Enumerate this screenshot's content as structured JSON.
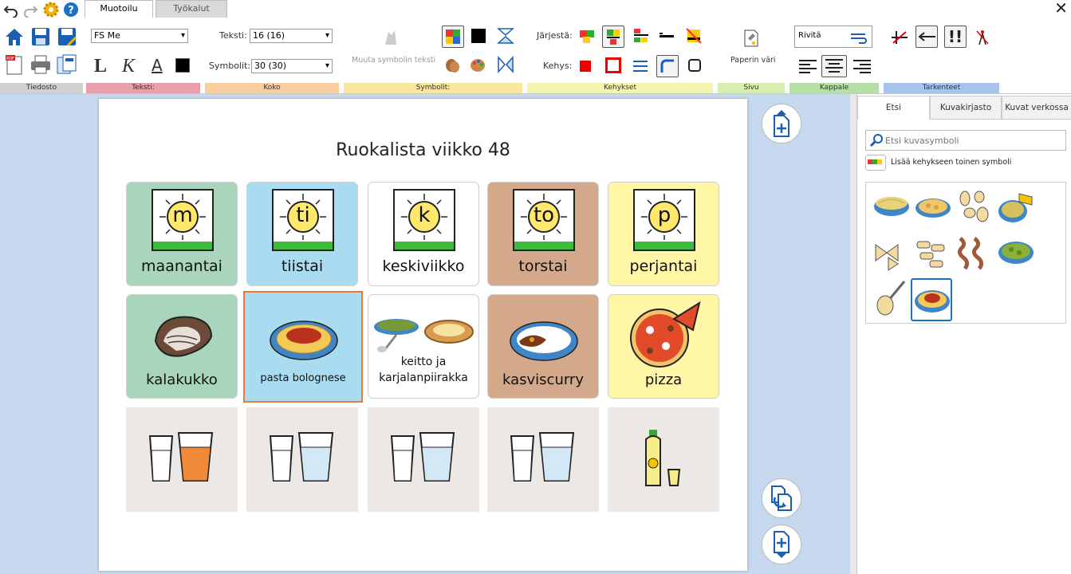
{
  "ribbon": {
    "tabs": [
      "Muotoilu",
      "Työkalut"
    ],
    "font_name": "FS Me",
    "text_size_label": "Teksti:",
    "text_size_value": "16 (16)",
    "symbol_size_label": "Symbolit:",
    "symbol_size_value": "30 (30)",
    "change_symbol_text": "Muuta symbolin teksti",
    "arrange_label": "Järjestä:",
    "frame_label": "Kehys:",
    "paper_color": "Paperin väri",
    "wrap_label": "Rivitä",
    "bold_glyph": "L",
    "italic_glyph": "K",
    "underline_glyph": "A",
    "groups": {
      "file": "Tiedosto",
      "text": "Teksti:",
      "size": "Koko",
      "symbols": "Symbolit:",
      "frames": "Kehykset",
      "page": "Sivu",
      "paragraph": "Kappale",
      "refine": "Tarkenteet"
    },
    "group_colors": {
      "file": "#d0d0d0",
      "text": "#e8a0aa",
      "size": "#f8cfa0",
      "symbols": "#f8e7a0",
      "frames": "#f5f3b0",
      "page": "#d6efb0",
      "paragraph": "#b6dfa8",
      "refine": "#a9c4ea"
    }
  },
  "document": {
    "title": "Ruokalista viikko 48",
    "days": [
      {
        "letter": "m",
        "label": "maanantai",
        "color": "#a8d5bc"
      },
      {
        "letter": "ti",
        "label": "tiistai",
        "color": "#a9dcf0"
      },
      {
        "letter": "k",
        "label": "keskiviikko",
        "color": "#ffffff"
      },
      {
        "letter": "to",
        "label": "torstai",
        "color": "#d4a88a"
      },
      {
        "letter": "p",
        "label": "perjantai",
        "color": "#fff6a6"
      }
    ],
    "meals": [
      {
        "label": "kalakukko",
        "color": "#a8d5bc"
      },
      {
        "label": "pasta bolognese",
        "color": "#a9dcf0"
      },
      {
        "label": "keitto ja\nkarjalanpiirakka",
        "color": "#ffffff"
      },
      {
        "label": "kasviscurry",
        "color": "#d4a88a"
      },
      {
        "label": "pizza",
        "color": "#fff6a6"
      }
    ],
    "drinks_color": "#ebe8e6"
  },
  "sidepanel": {
    "tabs": [
      "Etsi",
      "Kuvakirjasto",
      "Kuvat verkossa"
    ],
    "search_placeholder": "Etsi kuvasymboli",
    "add_second_symbol": "Lisää kehykseen toinen symboli"
  }
}
